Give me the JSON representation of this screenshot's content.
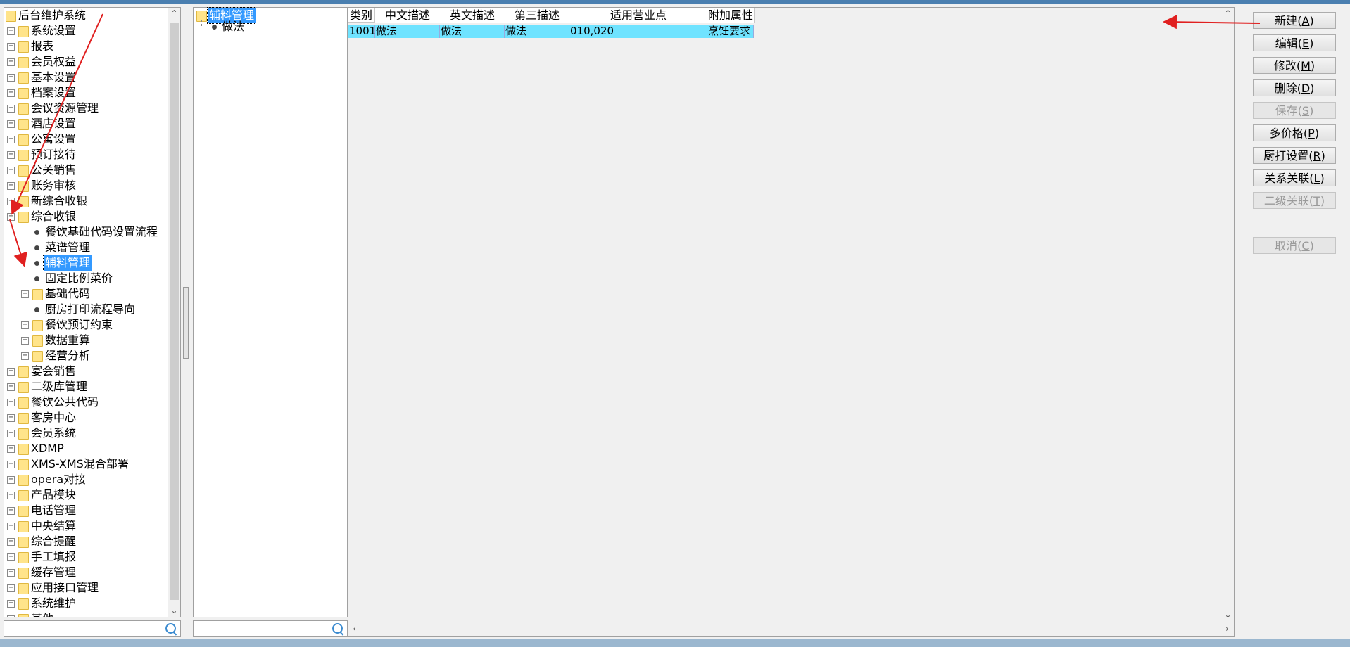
{
  "left_tree": {
    "items": [
      {
        "label": "后台维护系统",
        "level": 0,
        "kind": "folder",
        "expand": ""
      },
      {
        "label": "系统设置",
        "level": 1,
        "kind": "folder",
        "expand": "+"
      },
      {
        "label": "报表",
        "level": 1,
        "kind": "folder",
        "expand": "+"
      },
      {
        "label": "会员权益",
        "level": 1,
        "kind": "folder",
        "expand": "+"
      },
      {
        "label": "基本设置",
        "level": 1,
        "kind": "folder",
        "expand": "+"
      },
      {
        "label": "档案设置",
        "level": 1,
        "kind": "folder",
        "expand": "+"
      },
      {
        "label": "会议资源管理",
        "level": 1,
        "kind": "folder",
        "expand": "+"
      },
      {
        "label": "酒店设置",
        "level": 1,
        "kind": "folder",
        "expand": "+"
      },
      {
        "label": "公寓设置",
        "level": 1,
        "kind": "folder",
        "expand": "+"
      },
      {
        "label": "预订接待",
        "level": 1,
        "kind": "folder",
        "expand": "+"
      },
      {
        "label": "公关销售",
        "level": 1,
        "kind": "folder",
        "expand": "+"
      },
      {
        "label": "账务审核",
        "level": 1,
        "kind": "folder",
        "expand": "+"
      },
      {
        "label": "新综合收银",
        "level": 1,
        "kind": "folder",
        "expand": "+"
      },
      {
        "label": "综合收银",
        "level": 1,
        "kind": "folder",
        "expand": "−"
      },
      {
        "label": "餐饮基础代码设置流程",
        "level": 2,
        "kind": "leaf",
        "expand": ""
      },
      {
        "label": "菜谱管理",
        "level": 2,
        "kind": "leaf",
        "expand": ""
      },
      {
        "label": "辅料管理",
        "level": 2,
        "kind": "leaf",
        "expand": "",
        "selected": true
      },
      {
        "label": "固定比例菜价",
        "level": 2,
        "kind": "leaf",
        "expand": ""
      },
      {
        "label": "基础代码",
        "level": 2,
        "kind": "folder",
        "expand": "+"
      },
      {
        "label": "厨房打印流程导向",
        "level": 2,
        "kind": "leaf",
        "expand": ""
      },
      {
        "label": "餐饮预订约束",
        "level": 2,
        "kind": "folder",
        "expand": "+"
      },
      {
        "label": "数据重算",
        "level": 2,
        "kind": "folder",
        "expand": "+"
      },
      {
        "label": "经营分析",
        "level": 2,
        "kind": "folder",
        "expand": "+"
      },
      {
        "label": "宴会销售",
        "level": 1,
        "kind": "folder",
        "expand": "+"
      },
      {
        "label": "二级库管理",
        "level": 1,
        "kind": "folder",
        "expand": "+"
      },
      {
        "label": "餐饮公共代码",
        "level": 1,
        "kind": "folder",
        "expand": "+"
      },
      {
        "label": "客房中心",
        "level": 1,
        "kind": "folder",
        "expand": "+"
      },
      {
        "label": "会员系统",
        "level": 1,
        "kind": "folder",
        "expand": "+"
      },
      {
        "label": "XDMP",
        "level": 1,
        "kind": "folder",
        "expand": "+"
      },
      {
        "label": "XMS-XMS混合部署",
        "level": 1,
        "kind": "folder",
        "expand": "+"
      },
      {
        "label": "opera对接",
        "level": 1,
        "kind": "folder",
        "expand": "+"
      },
      {
        "label": "产品模块",
        "level": 1,
        "kind": "folder",
        "expand": "+"
      },
      {
        "label": "电话管理",
        "level": 1,
        "kind": "folder",
        "expand": "+"
      },
      {
        "label": "中央结算",
        "level": 1,
        "kind": "folder",
        "expand": "+"
      },
      {
        "label": "综合提醒",
        "level": 1,
        "kind": "folder",
        "expand": "+"
      },
      {
        "label": "手工填报",
        "level": 1,
        "kind": "folder",
        "expand": "+"
      },
      {
        "label": "缓存管理",
        "level": 1,
        "kind": "folder",
        "expand": "+"
      },
      {
        "label": "应用接口管理",
        "level": 1,
        "kind": "folder",
        "expand": "+"
      },
      {
        "label": "系统维护",
        "level": 1,
        "kind": "folder",
        "expand": "+"
      },
      {
        "label": "其他",
        "level": 1,
        "kind": "folder",
        "expand": "+"
      }
    ]
  },
  "mid_tree": {
    "root": "辅料管理",
    "child": "做法"
  },
  "grid": {
    "columns": [
      "类别",
      "中文描述",
      "英文描述",
      "第三描述",
      "适用营业点",
      "附加属性"
    ],
    "rows": [
      [
        "1001",
        "做法",
        "做法",
        "做法",
        "010,020",
        "烹饪要求"
      ]
    ]
  },
  "buttons": [
    {
      "id": "new",
      "text": "新建",
      "key": "A",
      "disabled": false
    },
    {
      "id": "edit",
      "text": "编辑",
      "key": "E",
      "disabled": false
    },
    {
      "id": "modify",
      "text": "修改",
      "key": "M",
      "disabled": false
    },
    {
      "id": "delete",
      "text": "删除",
      "key": "D",
      "disabled": false
    },
    {
      "id": "save",
      "text": "保存",
      "key": "S",
      "disabled": true
    },
    {
      "id": "multi-price",
      "text": "多价格",
      "key": "P",
      "disabled": false
    },
    {
      "id": "kitchen-print",
      "text": "厨打设置",
      "key": "R",
      "disabled": false
    },
    {
      "id": "relation",
      "text": "关系关联",
      "key": "L",
      "disabled": false
    },
    {
      "id": "second-relation",
      "text": "二级关联",
      "key": "T",
      "disabled": true
    },
    {
      "id": "cancel",
      "text": "取消",
      "key": "C",
      "disabled": true
    }
  ],
  "colors": {
    "selection": "#3399ff",
    "row_highlight": "#6fe3ff",
    "annotation_arrow": "#e02020"
  }
}
